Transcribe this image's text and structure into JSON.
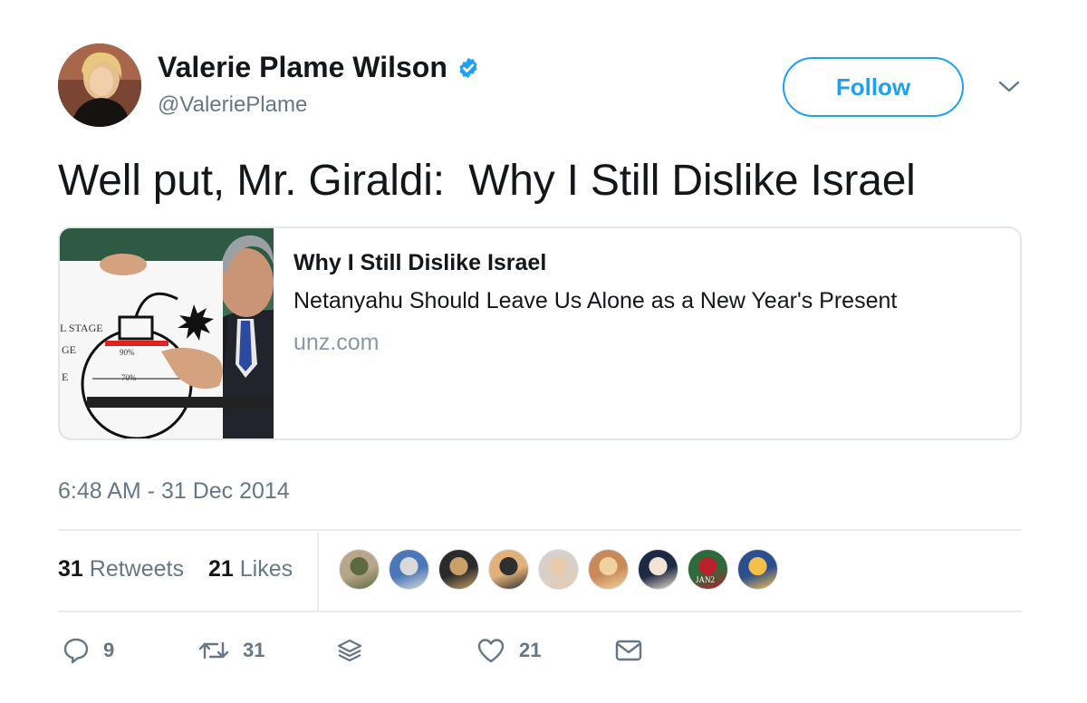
{
  "author": {
    "display_name": "Valerie Plame Wilson",
    "handle": "@ValeriePlame",
    "verified": true
  },
  "follow_label": "Follow",
  "tweet": {
    "text": "Well put, Mr. Giraldi:  Why I Still Dislike Israel",
    "timestamp": "6:48 AM - 31 Dec 2014"
  },
  "card": {
    "title": "Why I Still Dislike Israel",
    "description": "Netanyahu Should Leave Us Alone as a New Year's Present",
    "domain": "unz.com",
    "image_text": {
      "stage": "L STAGE",
      "ge": "GE",
      "e": "E",
      "pct90": "90%",
      "pct70": "70%"
    }
  },
  "stats": {
    "retweets_count": "31",
    "retweets_label": "Retweets",
    "likes_count": "21",
    "likes_label": "Likes"
  },
  "liker_avatars": [
    {
      "colors": [
        "#b9a58a",
        "#5c6b3f"
      ]
    },
    {
      "colors": [
        "#4a78b8",
        "#d9d9d9"
      ]
    },
    {
      "colors": [
        "#2b2b2b",
        "#c8a06a"
      ]
    },
    {
      "colors": [
        "#e2b07a",
        "#2f2f2f"
      ]
    },
    {
      "colors": [
        "#d8d0c8",
        "#e9c9a8"
      ]
    },
    {
      "colors": [
        "#c98a5a",
        "#f0d2a0"
      ]
    },
    {
      "colors": [
        "#1e2a44",
        "#f2e3d2"
      ]
    },
    {
      "colors": [
        "#2e6b3a",
        "#b8202a"
      ],
      "text": "JAN2"
    },
    {
      "colors": [
        "#2c4e8c",
        "#f5c04a"
      ]
    }
  ],
  "actions": {
    "reply_count": "9",
    "retweet_count": "31",
    "like_count": "21"
  },
  "colors": {
    "accent": "#1da1f2",
    "text": "#14171a",
    "secondary": "#657786",
    "border": "#e1e8ed"
  },
  "icons": [
    "verified-badge-icon",
    "chevron-down-icon",
    "reply-icon",
    "retweet-icon",
    "stack-icon",
    "heart-icon",
    "envelope-icon"
  ]
}
